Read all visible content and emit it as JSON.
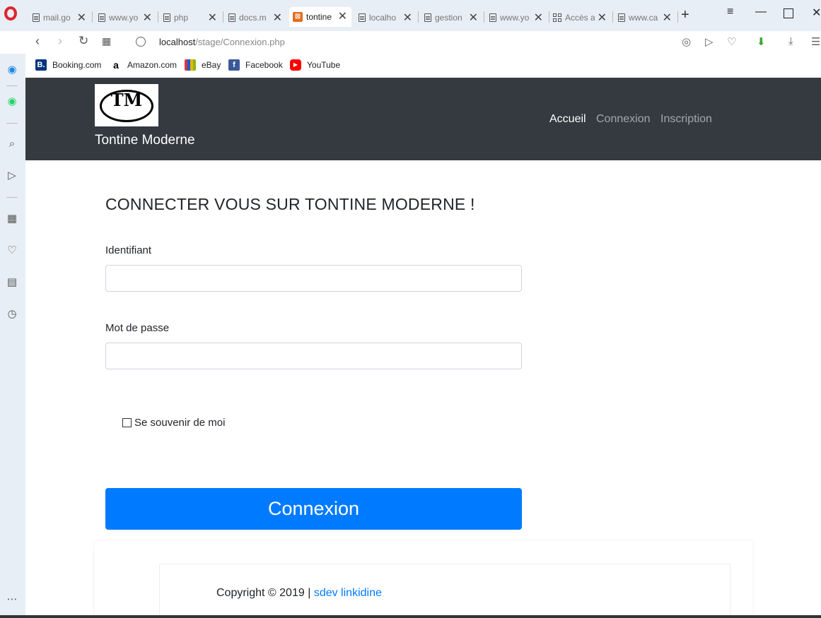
{
  "browser": {
    "tabs": [
      {
        "title": "mail.go"
      },
      {
        "title": "www.yo"
      },
      {
        "title": "php"
      },
      {
        "title": "docs.m"
      },
      {
        "title": "tontine"
      },
      {
        "title": "localho"
      },
      {
        "title": "gestion"
      },
      {
        "title": "www.yo"
      },
      {
        "title": "Accès a"
      },
      {
        "title": "www.ca"
      }
    ],
    "url_host": "localhost",
    "url_path": "/stage/Connexion.php",
    "bookmarks": [
      {
        "label": "Booking.com",
        "icon": "booking-icon",
        "color": "#003580",
        "glyph": "B."
      },
      {
        "label": "Amazon.com",
        "icon": "amazon-icon",
        "color": "#ffffff",
        "glyph": "a"
      },
      {
        "label": "eBay",
        "icon": "ebay-icon",
        "color": "#ffffff",
        "glyph": "e"
      },
      {
        "label": "Facebook",
        "icon": "facebook-icon",
        "color": "#3b5998",
        "glyph": "f"
      },
      {
        "label": "YouTube",
        "icon": "youtube-icon",
        "color": "#ff0000",
        "glyph": "▶"
      }
    ]
  },
  "site": {
    "brand": "Tontine Moderne",
    "logo_text": "TM",
    "nav": {
      "home": "Accueil",
      "login": "Connexion",
      "register": "Inscription"
    },
    "colors": {
      "navbar": "#343a40",
      "primary": "#007bff"
    }
  },
  "form": {
    "heading": "CONNECTER VOUS SUR TONTINE MODERNE !",
    "username_label": "Identifiant",
    "username_value": "",
    "password_label": "Mot de passe",
    "password_value": "",
    "remember_label": "Se souvenir de moi",
    "submit_label": "Connexion"
  },
  "footer": {
    "copyright": "Copyright © 2019 |",
    "author": "sdev linkidine"
  }
}
